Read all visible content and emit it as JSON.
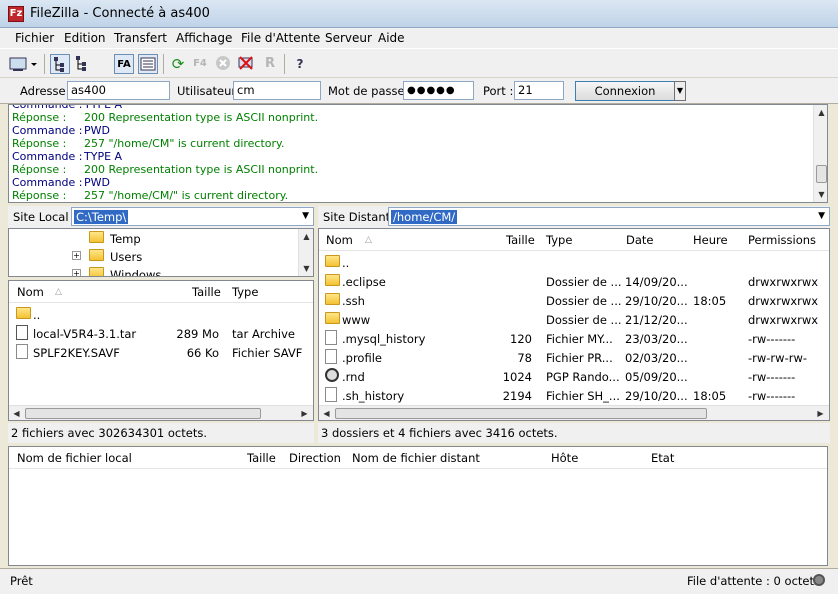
{
  "window": {
    "title": "FileZilla - Connecté à as400",
    "app_icon": "Fz"
  },
  "menu": [
    "Fichier",
    "Edition",
    "Transfert",
    "Affichage",
    "File d'Attente",
    "Serveur",
    "Aide"
  ],
  "toolbar": {
    "icons": [
      "site-manager-icon",
      "toggle-log-icon",
      "toggle-local-tree-icon",
      "toggle-remote-tree-icon",
      "toggle-queue-icon",
      "refresh-icon",
      "process-queue-icon",
      "cancel-icon",
      "disconnect-icon",
      "reconnect-icon",
      "help-icon"
    ],
    "fa_label": "FA",
    "f4_label": "F4",
    "r_label": "R",
    "help_label": "?"
  },
  "quickconnect": {
    "host_label": "Adresse :",
    "host_value": "as400",
    "user_label": "Utilisateur :",
    "user_value": "cm",
    "pass_label": "Mot de passe :",
    "pass_value": "●●●●●",
    "port_label": "Port :",
    "port_value": "21",
    "button_label": "Connexion Rapide"
  },
  "log": [
    {
      "key": "Commande :",
      "value": "TYPE A",
      "type": "cmd"
    },
    {
      "key": "Réponse :",
      "value": "200 Representation type is ASCII nonprint.",
      "type": "resp"
    },
    {
      "key": "Commande :",
      "value": "PWD",
      "type": "cmd"
    },
    {
      "key": "Réponse :",
      "value": "257 \"/home/CM\" is current directory.",
      "type": "resp"
    },
    {
      "key": "Commande :",
      "value": "TYPE A",
      "type": "cmd"
    },
    {
      "key": "Réponse :",
      "value": "200 Representation type is ASCII nonprint.",
      "type": "resp"
    },
    {
      "key": "Commande :",
      "value": "PWD",
      "type": "cmd"
    },
    {
      "key": "Réponse :",
      "value": "257 \"/home/CM/\" is current directory.",
      "type": "resp"
    }
  ],
  "colors": {
    "command": "#000080",
    "response": "#008000",
    "selection": "#316ac5"
  },
  "local": {
    "site_label": "Site Local :",
    "path": "C:\\Temp\\",
    "tree": [
      "Temp",
      "Users",
      "Windows"
    ],
    "columns": [
      "Nom",
      "Taille",
      "Type"
    ],
    "files": [
      {
        "name": "..",
        "size": "",
        "type": "",
        "icon": "folder"
      },
      {
        "name": "local-V5R4-3.1.tar",
        "size": "289 Mo",
        "type": "tar Archive",
        "icon": "archive"
      },
      {
        "name": "SPLF2KEY.SAVF",
        "size": "66 Ko",
        "type": "Fichier SAVF",
        "icon": "file"
      }
    ],
    "status": "2 fichiers avec 302634301 octets."
  },
  "remote": {
    "site_label": "Site Distant :",
    "path": "/home/CM/",
    "columns": [
      "Nom",
      "Taille",
      "Type",
      "Date",
      "Heure",
      "Permissions"
    ],
    "files": [
      {
        "name": "..",
        "size": "",
        "type": "",
        "date": "",
        "time": "",
        "perms": "",
        "icon": "folder"
      },
      {
        "name": ".eclipse",
        "size": "",
        "type": "Dossier de ...",
        "date": "14/09/20...",
        "time": "",
        "perms": "drwxrwxrwx",
        "icon": "folder"
      },
      {
        "name": ".ssh",
        "size": "",
        "type": "Dossier de ...",
        "date": "29/10/20...",
        "time": "18:05",
        "perms": "drwxrwxrwx",
        "icon": "folder"
      },
      {
        "name": "www",
        "size": "",
        "type": "Dossier de ...",
        "date": "21/12/20...",
        "time": "",
        "perms": "drwxrwxrwx",
        "icon": "folder"
      },
      {
        "name": ".mysql_history",
        "size": "120",
        "type": "Fichier MY...",
        "date": "23/03/20...",
        "time": "",
        "perms": "-rw-------",
        "icon": "file"
      },
      {
        "name": ".profile",
        "size": "78",
        "type": "Fichier PR...",
        "date": "02/03/20...",
        "time": "",
        "perms": "-rw-rw-rw-",
        "icon": "file"
      },
      {
        "name": ".rnd",
        "size": "1024",
        "type": "PGP Rando...",
        "date": "05/09/20...",
        "time": "",
        "perms": "-rw-------",
        "icon": "pgp"
      },
      {
        "name": ".sh_history",
        "size": "2194",
        "type": "Fichier SH_...",
        "date": "29/10/20...",
        "time": "18:05",
        "perms": "-rw-------",
        "icon": "file"
      }
    ],
    "status": "3 dossiers et 4 fichiers avec 3416 octets."
  },
  "queue": {
    "columns": [
      "Nom de fichier local",
      "Taille",
      "Direction",
      "Nom de fichier distant",
      "Hôte",
      "Etat"
    ]
  },
  "statusbar": {
    "left": "Prêt",
    "right": "File d'attente : 0 octets"
  }
}
